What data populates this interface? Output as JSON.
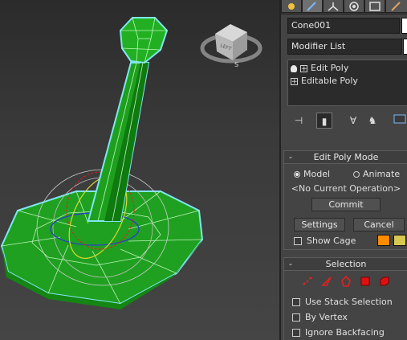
{
  "panel": {
    "object_name": "Cone001",
    "object_color": "#ffffff",
    "modifier_list_label": "Modifier List",
    "stack": [
      {
        "label": "Edit Poly"
      },
      {
        "label": "Editable Poly"
      }
    ],
    "edit_poly_mode": {
      "title": "Edit Poly Mode",
      "collapse": "-",
      "model_label": "Model",
      "animate_label": "Animate",
      "status": "<No Current Operation>",
      "commit_label": "Commit",
      "settings_label": "Settings",
      "cancel_label": "Cancel",
      "show_cage_label": "Show Cage",
      "cage_color_1": "#ff8c00",
      "cage_color_2": "#d8c850"
    },
    "selection": {
      "title": "Selection",
      "collapse": "-",
      "use_stack_label": "Use Stack Selection",
      "by_vertex_label": "By Vertex",
      "ignore_backfacing_label": "Ignore Backfacing"
    }
  },
  "viewcube": {
    "face_label": "LEFT",
    "compass_s": "S"
  }
}
